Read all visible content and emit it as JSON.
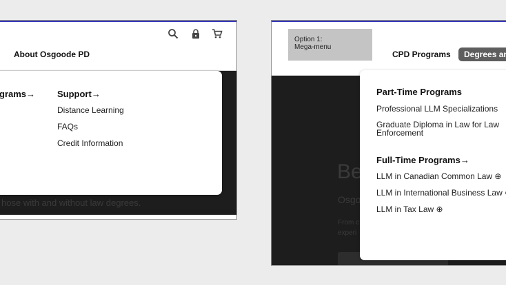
{
  "left_panel": {
    "nav_link": "About Osgoode PD",
    "menu": {
      "col1_heading": "grams→",
      "col2_heading": "Support→",
      "col2_items": [
        "Distance Learning",
        "FAQs",
        "Credit Information"
      ]
    },
    "hero_text": "hose with and without law degrees.",
    "icons": [
      "search-icon",
      "lock-icon",
      "cart-icon"
    ]
  },
  "right_panel": {
    "placeholder_label": "Option 1:\nMega-menu",
    "nav_link": "CPD Programs",
    "active_tab": "Degrees and",
    "menu": {
      "section1_heading": "Part-Time Programs",
      "section1_items": [
        "Professional LLM Specializations",
        "Graduate Diploma in Law for Law Enforcement"
      ],
      "section2_heading": "Full-Time Programs→",
      "section2_items": [
        "LLM in Canadian Common Law ⊕",
        "LLM in International Business Law ⊕",
        "LLM in Tax Law ⊕"
      ]
    },
    "hero_fragments": [
      "Be",
      "Osgo",
      "From c",
      "experi"
    ]
  },
  "colors": {
    "accent": "#3b3bbd",
    "dark_bg": "#1d1d1d",
    "pill_bg": "#5e5e5e"
  }
}
